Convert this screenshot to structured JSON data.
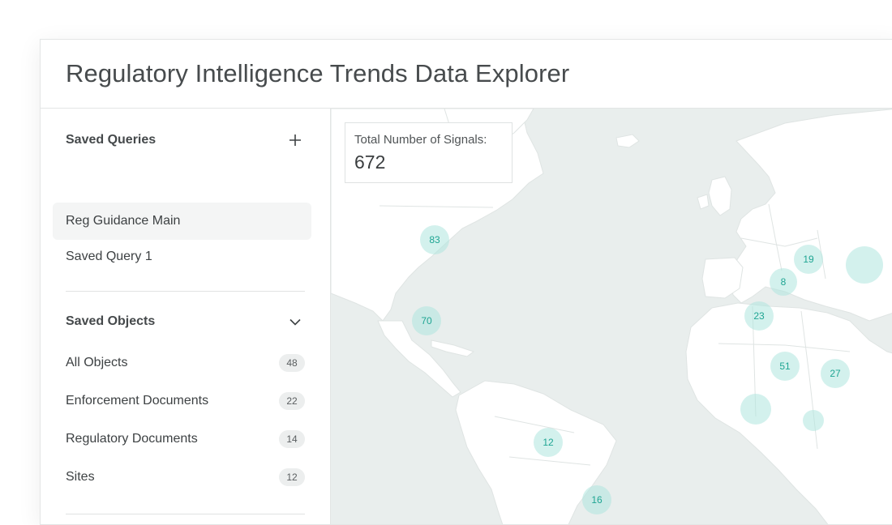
{
  "title": "Regulatory Intelligence Trends Data Explorer",
  "sidebar": {
    "saved_queries": {
      "label": "Saved Queries",
      "items": [
        {
          "label": "Reg Guidance Main"
        },
        {
          "label": "Saved Query 1"
        }
      ]
    },
    "saved_objects": {
      "label": "Saved Objects",
      "items": [
        {
          "label": "All Objects",
          "count": "48"
        },
        {
          "label": "Enforcement Documents",
          "count": "22"
        },
        {
          "label": "Regulatory Documents",
          "count": "14"
        },
        {
          "label": "Sites",
          "count": "12"
        }
      ]
    }
  },
  "map": {
    "stat_label": "Total Number of Signals:",
    "stat_value": "672",
    "clusters": [
      {
        "label": "83"
      },
      {
        "label": "70"
      },
      {
        "label": "19"
      },
      {
        "label": "8"
      },
      {
        "label": "23"
      },
      {
        "label": "51"
      },
      {
        "label": "27"
      },
      {
        "label": "12"
      },
      {
        "label": "16"
      },
      {
        "label": ""
      },
      {
        "label": ""
      },
      {
        "label": ""
      }
    ]
  },
  "colors": {
    "map_land": "#ffffff",
    "map_water": "#e9eeed",
    "cluster_fill": "#afe6de",
    "cluster_text": "#1fa593"
  }
}
